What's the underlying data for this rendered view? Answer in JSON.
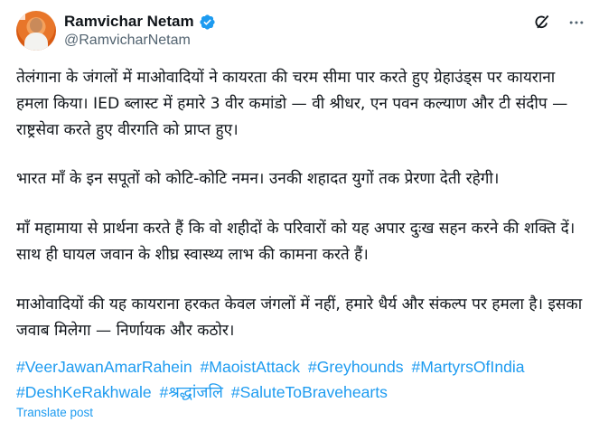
{
  "author": {
    "name": "Ramvichar Netam",
    "handle": "@RamvicharNetam",
    "verified": true
  },
  "icons": {
    "verified": "verified-badge-icon",
    "grok": "grok-icon",
    "more": "more-icon"
  },
  "colors": {
    "link": "#1d9bf0",
    "text": "#0f1419",
    "muted": "#536471"
  },
  "tweet": {
    "paragraphs": [
      "तेलंगाना के जंगलों में माओवादियों ने कायरता की चरम सीमा पार करते हुए ग्रेहाउंड्स पर कायराना हमला किया। IED ब्लास्ट में हमारे 3 वीर कमांडो — वी श्रीधर, एन पवन कल्याण और टी संदीप — राष्ट्रसेवा करते हुए वीरगति को प्राप्त हुए।",
      "भारत माँ के इन सपूतों को कोटि-कोटि नमन। उनकी शहादत युगों तक प्रेरणा देती रहेगी।",
      "माँ महामाया से प्रार्थना करते हैं कि वो शहीदों के परिवारों को यह अपार दुःख सहन करने की शक्ति दें। साथ ही घायल जवान के शीघ्र स्वास्थ्य लाभ की कामना करते हैं।",
      "माओवादियों की यह कायराना हरकत केवल जंगलों में नहीं, हमारे धैर्य और संकल्प पर हमला है। इसका जवाब मिलेगा — निर्णायक और कठोर।"
    ],
    "hashtags": [
      "#VeerJawanAmarRahein",
      "#MaoistAttack",
      "#Greyhounds",
      "#MartyrsOfIndia",
      "#DeshKeRakhwale",
      "#श्रद्धांजलि",
      "#SaluteToBravehearts"
    ]
  },
  "translate_label": "Translate post"
}
